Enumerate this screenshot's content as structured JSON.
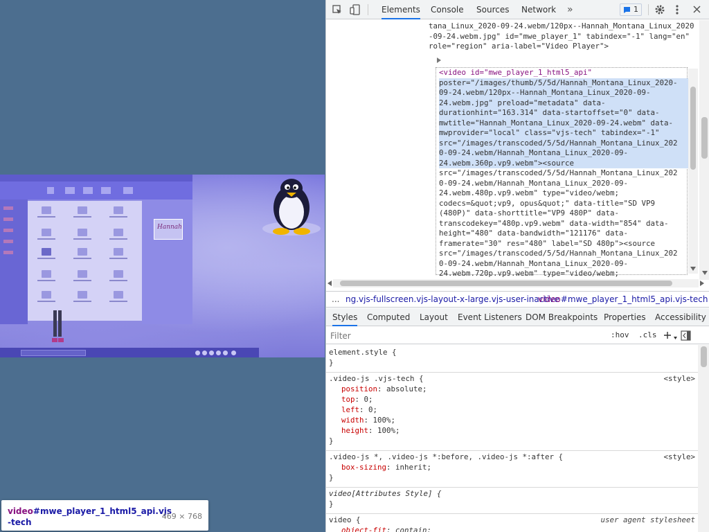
{
  "tooltip": {
    "tag": "video",
    "rest": "#mwe_player_1_html5_api.vjs",
    "rest2": "-tech",
    "size": "469 × 768"
  },
  "hannah_logo": "Hannah",
  "devtools": {
    "tabs": [
      "Elements",
      "Console",
      "Sources",
      "Network"
    ],
    "more": "»",
    "issues_count": "1",
    "elements": {
      "pre_lines": [
        "tana_Linux_2020-09-24.webm/120px--Hannah_Montana_Linux_2020",
        "-09-24.webm.jpg\" id=\"mwe_player_1\" tabindex=\"-1\" lang=\"en\"",
        "role=\"region\" aria-label=\"Video Player\">"
      ],
      "node_lines": [
        "<video id=\"mwe_player_1_html5_api\"",
        "poster=\"/images/thumb/5/5d/Hannah_Montana_Linux_2020-",
        "09-24.webm/120px--Hannah_Montana_Linux_2020-09-",
        "24.webm.jpg\" preload=\"metadata\" data-",
        "durationhint=\"163.314\" data-startoffset=\"0\" data-",
        "mwtitle=\"Hannah_Montana_Linux_2020-09-24.webm\" data-",
        "mwprovider=\"local\" class=\"vjs-tech\" tabindex=\"-1\"",
        "src=\"/images/transcoded/5/5d/Hannah_Montana_Linux_202",
        "0-09-24.webm/Hannah_Montana_Linux_2020-09-",
        "24.webm.360p.vp9.webm\"><source",
        "src=\"/images/transcoded/5/5d/Hannah_Montana_Linux_202",
        "0-09-24.webm/Hannah_Montana_Linux_2020-09-",
        "24.webm.480p.vp9.webm\" type=\"video/webm;",
        "codecs=&quot;vp9, opus&quot;\" data-title=\"SD VP9",
        "(480P)\" data-shorttitle=\"VP9 480P\" data-",
        "transcodekey=\"480p.vp9.webm\" data-width=\"854\" data-",
        "height=\"480\" data-bandwidth=\"121176\" data-",
        "framerate=\"30\" res=\"480\" label=\"SD 480p\"><source",
        "src=\"/images/transcoded/5/5d/Hannah_Montana_Linux_202",
        "0-09-24.webm/Hannah_Montana_Linux_2020-09-",
        "24.webm.720p.vp9.webm\" type=\"video/webm;"
      ]
    },
    "breadcrumb": {
      "ellipsis": "...",
      "parent": "ng.vjs-fullscreen.vjs-layout-x-large.vjs-user-inactive",
      "current_tag": "video",
      "current_rest": "#mwe_player_1_html5_api.vjs-tech"
    },
    "styles_tabs": [
      "Styles",
      "Computed",
      "Layout",
      "Event Listeners",
      "DOM Breakpoints",
      "Properties",
      "Accessibility"
    ],
    "filter": {
      "placeholder": "Filter",
      "hov": ":hov",
      "cls": ".cls"
    },
    "rules": [
      {
        "selector": "element.style {",
        "source": "",
        "props": [],
        "close": "}"
      },
      {
        "selector": ".video-js .vjs-tech {",
        "source": "<style>",
        "props": [
          [
            "position",
            "absolute;"
          ],
          [
            "top",
            "0;"
          ],
          [
            "left",
            "0;"
          ],
          [
            "width",
            "100%;"
          ],
          [
            "height",
            "100%;"
          ]
        ],
        "close": "}"
      },
      {
        "selector": ".video-js *, .video-js *:before, .video-js *:after {",
        "source": "<style>",
        "props": [
          [
            "box-sizing",
            "inherit;"
          ]
        ],
        "close": "}"
      },
      {
        "selector": "video[Attributes Style] {",
        "source": "",
        "props": [],
        "close": "}"
      },
      {
        "selector": "video {",
        "source": "user agent stylesheet",
        "props": [
          [
            "object-fit",
            "contain;"
          ]
        ],
        "close": "}"
      }
    ]
  }
}
